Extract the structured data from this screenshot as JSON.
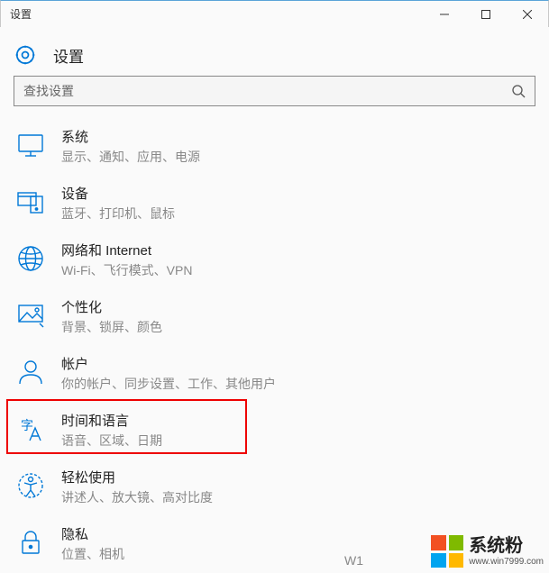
{
  "window": {
    "title": "设置"
  },
  "header": {
    "title": "设置"
  },
  "search": {
    "placeholder": "查找设置"
  },
  "items": [
    {
      "title": "系统",
      "desc": "显示、通知、应用、电源"
    },
    {
      "title": "设备",
      "desc": "蓝牙、打印机、鼠标"
    },
    {
      "title": "网络和 Internet",
      "desc": "Wi-Fi、飞行模式、VPN"
    },
    {
      "title": "个性化",
      "desc": "背景、锁屏、颜色"
    },
    {
      "title": "帐户",
      "desc": "你的帐户、同步设置、工作、其他用户"
    },
    {
      "title": "时间和语言",
      "desc": "语音、区域、日期"
    },
    {
      "title": "轻松使用",
      "desc": "讲述人、放大镜、高对比度"
    },
    {
      "title": "隐私",
      "desc": "位置、相机"
    }
  ],
  "watermark": {
    "partial": "W1",
    "brand": "系统粉",
    "url": "www.win7999.com"
  }
}
